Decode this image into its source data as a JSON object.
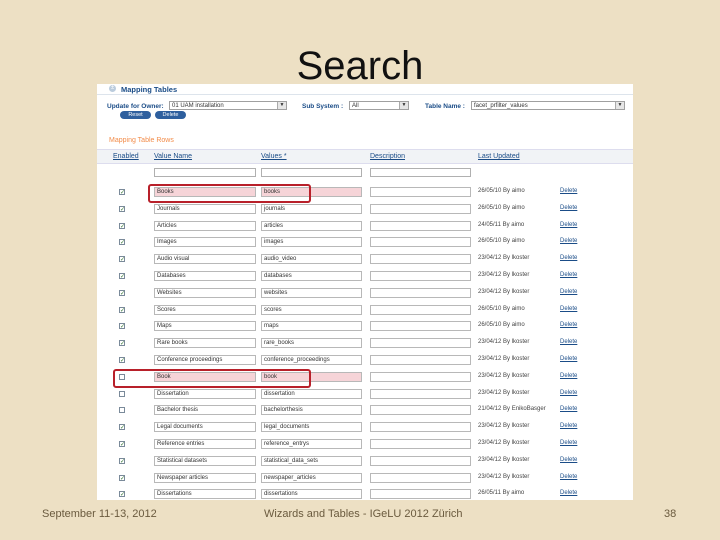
{
  "slide": {
    "title": "Search",
    "footer_left": "September 11-13, 2012",
    "footer_center": "Wizards and Tables - IGeLU 2012 Zürich",
    "page_number": "38"
  },
  "panel": {
    "expander": "±",
    "title": "Mapping Tables"
  },
  "filters": {
    "owner_label": "Update for Owner:",
    "owner_value": "01 UAM installation",
    "subsystem_label": "Sub System :",
    "subsystem_value": "All",
    "table_label": "Table Name :",
    "table_value": "facet_prfilter_values",
    "reset_label": "Reset",
    "delete_label": "Delete"
  },
  "section_title": "Mapping Table Rows",
  "columns": {
    "enabled": "Enabled",
    "value_name": "Value Name",
    "values": "Values *",
    "description": "Description",
    "last_updated": "Last Updated"
  },
  "delete_link": "Delete",
  "rows": [
    {
      "enabled": true,
      "name": "Books",
      "value": "books",
      "updated": "26/05/10  By aimo",
      "highlight": true
    },
    {
      "enabled": true,
      "name": "Journals",
      "value": "journals",
      "updated": "26/05/10  By aimo",
      "highlight": false
    },
    {
      "enabled": true,
      "name": "Articles",
      "value": "articles",
      "updated": "24/05/11  By aimo",
      "highlight": false
    },
    {
      "enabled": true,
      "name": "Images",
      "value": "images",
      "updated": "26/05/10  By aimo",
      "highlight": false
    },
    {
      "enabled": true,
      "name": "Audio visual",
      "value": "audio_video",
      "updated": "23/04/12  By lkoster",
      "highlight": false
    },
    {
      "enabled": true,
      "name": "Databases",
      "value": "databases",
      "updated": "23/04/12  By lkoster",
      "highlight": false
    },
    {
      "enabled": true,
      "name": "Websites",
      "value": "websites",
      "updated": "23/04/12  By lkoster",
      "highlight": false
    },
    {
      "enabled": true,
      "name": "Scores",
      "value": "scores",
      "updated": "26/05/10  By aimo",
      "highlight": false
    },
    {
      "enabled": true,
      "name": "Maps",
      "value": "maps",
      "updated": "26/05/10  By aimo",
      "highlight": false
    },
    {
      "enabled": true,
      "name": "Rare books",
      "value": "rare_books",
      "updated": "23/04/12  By lkoster",
      "highlight": false
    },
    {
      "enabled": true,
      "name": "Conference proceedings",
      "value": "conference_proceedings",
      "updated": "23/04/12  By lkoster",
      "highlight": false
    },
    {
      "enabled": false,
      "name": "Book",
      "value": "book",
      "updated": "23/04/12  By lkoster",
      "highlight": true
    },
    {
      "enabled": false,
      "name": "Dissertation",
      "value": "dissertation",
      "updated": "23/04/12  By lkoster",
      "highlight": false
    },
    {
      "enabled": false,
      "name": "Bachelor thesis",
      "value": "bachelorthesis",
      "updated": "21/04/12  By EnikoBasger",
      "highlight": false
    },
    {
      "enabled": true,
      "name": "Legal documents",
      "value": "legal_documents",
      "updated": "23/04/12  By lkoster",
      "highlight": false
    },
    {
      "enabled": true,
      "name": "Reference entries",
      "value": "reference_entrys",
      "updated": "23/04/12  By lkoster",
      "highlight": false
    },
    {
      "enabled": true,
      "name": "Statistical datasets",
      "value": "statistical_data_sets",
      "updated": "23/04/12  By lkoster",
      "highlight": false
    },
    {
      "enabled": true,
      "name": "Newspaper articles",
      "value": "newspaper_articles",
      "updated": "23/04/12  By lkoster",
      "highlight": false
    },
    {
      "enabled": true,
      "name": "Dissertations",
      "value": "dissertations",
      "updated": "26/05/11  By aimo",
      "highlight": false
    }
  ]
}
